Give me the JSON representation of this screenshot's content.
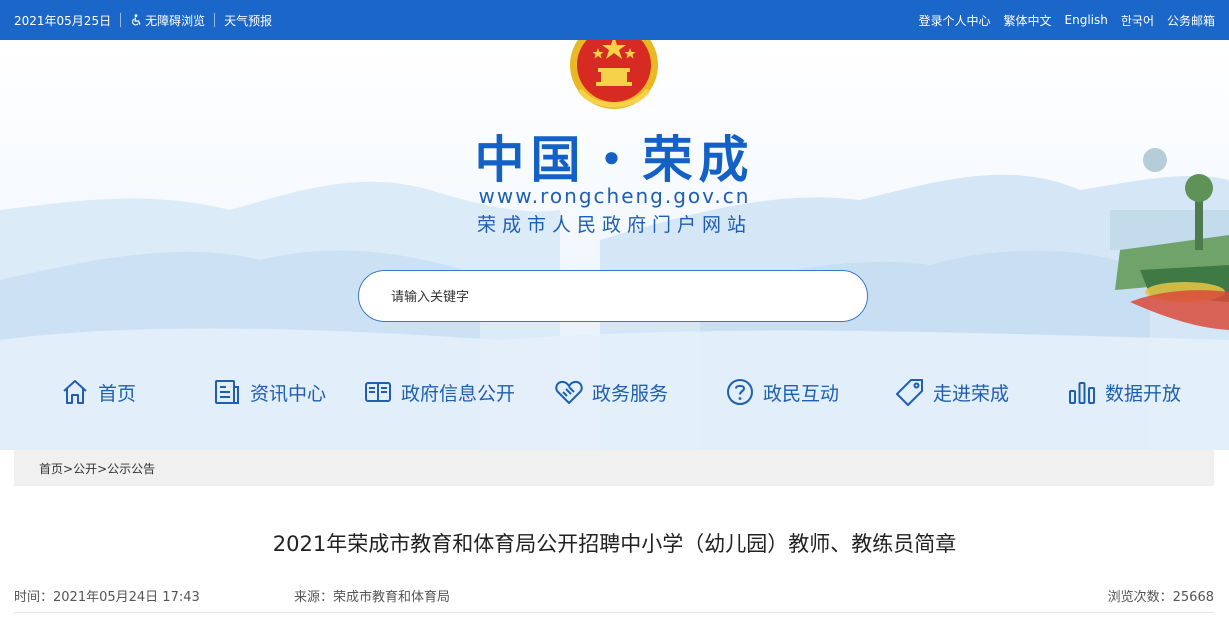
{
  "topbar": {
    "date": "2021年05月25日",
    "accessibility": "无障碍浏览",
    "weather": "天气预报",
    "links": [
      "登录个人中心",
      "繁体中文",
      "English",
      "한국어",
      "公务邮箱"
    ]
  },
  "header": {
    "title": "中国・荣成",
    "url": "www.rongcheng.gov.cn",
    "subtitle": "荣成市人民政府门户网站"
  },
  "search": {
    "placeholder": "请输入关键字"
  },
  "nav": {
    "items": [
      {
        "label": "首页",
        "icon": "home-icon"
      },
      {
        "label": "资讯中心",
        "icon": "news-icon"
      },
      {
        "label": "政府信息公开",
        "icon": "book-icon"
      },
      {
        "label": "政务服务",
        "icon": "handshake-icon"
      },
      {
        "label": "政民互动",
        "icon": "question-icon"
      },
      {
        "label": "走进荣成",
        "icon": "tag-icon"
      },
      {
        "label": "数据开放",
        "icon": "bar-chart-icon"
      }
    ]
  },
  "breadcrumb": {
    "items": [
      "首页",
      "公开",
      "公示公告"
    ],
    "separator": ">"
  },
  "article": {
    "title": "2021年荣成市教育和体育局公开招聘中小学（幼儿园）教师、教练员简章",
    "time": "时间：2021年05月24日 17:43",
    "source": "来源：荣成市教育和体育局",
    "views": "浏览次数：25668"
  },
  "colors": {
    "brand": "#1a66c9",
    "title": "#1361c4"
  }
}
